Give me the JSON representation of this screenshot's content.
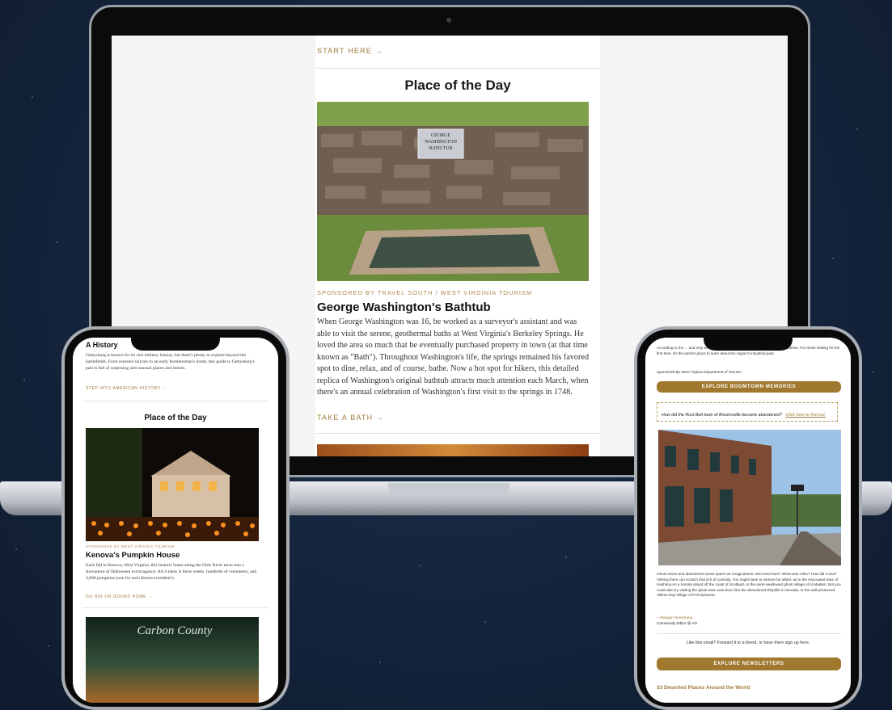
{
  "laptop": {
    "start_here": "START HERE →",
    "section_title": "Place of the Day",
    "sign_text": "GEORGE WASHINGTON BATH TUB",
    "sponsor": "SPONSORED BY TRAVEL SOUTH / WEST VIRGINIA TOURISM",
    "headline": "George Washington's Bathtub",
    "body": "When George Washington was 16, be worked as a surveyor's assistant and was able to visit the serene, geothermal baths at West Virginia's Berkeley Springs. He loved the area so much that he eventually purchased property in town (at that time known as \"Bath\"). Throughout Washington's life, the springs remained his favored spot to dine, relax, and of course, bathe. Now a hot spot for hikers, this detailed replica of Washington's original bathtub attracts much attention each March, when there's an annual celebration of Washington's first visit to the springs in 1748.",
    "cta": "TAKE A BATH →"
  },
  "phone_left": {
    "heading": "A History",
    "intro": "Gettysburg is known for its rich military history, but there's plenty to explore beyond the battlefields. From restored railcars to an early frontiersman's home, this guide to Gettysburg's past is full of surprising and unusual places and stories.",
    "intro_link": "STEP INTO AMERICAN HISTORY →",
    "section_title": "Place of the Day",
    "sponsor": "SPONSORED BY WEST VIRGINIA TOURISM",
    "headline": "Kenova's Pumpkin House",
    "body": "Each fall in Kenova, West Virginia, this historic home along the Ohio River turns into a showpiece of Halloween extravagance. All it takes is three weeks, hundreds of volunteers, and 3,000 pumpkins (one for each Kenova resident!).",
    "cta": "GO BIG OR GOURD HOME →",
    "poster_title": "Carbon County"
  },
  "phone_right": {
    "intro": "According to the ... and only several, and hosts an annual reunion for former residents. For those visiting for the first time, it's the perfect place to learn about the region's industrial past.",
    "sponsor": "Sponsored By West Virginia Department of Tourism",
    "button1": "EXPLORE BOOMTOWN MEMORIES",
    "callout": "How did the Rust Belt town of Brownsville become abandoned?",
    "callout_link": "Click here to find out.",
    "body": "Ghost towns and abandoned areas spark our imaginations: who lived here? What was it like? How did it end? Visiting them can scratch that itch of curiosity. You might have to venture far afield, as to the evacuated town of Hashima on a remote island off the coast of Scotland, or the sand-swallowed ghost village of Al Madam. But you could also try visiting the ghost town next door, like the abandoned Rhyolite in Nevada, or the well-preserved Yellow Dog Village of Pennsylvania.",
    "author_name": "—Reagan Rosenberg",
    "author_role": "Community Editor @ AO",
    "share_text": "Like this email? Forward it to a friend, or have them sign up here.",
    "button2": "EXPLORE NEWSLETTERS",
    "footer_title": "33 Deserted Places Around the World"
  }
}
